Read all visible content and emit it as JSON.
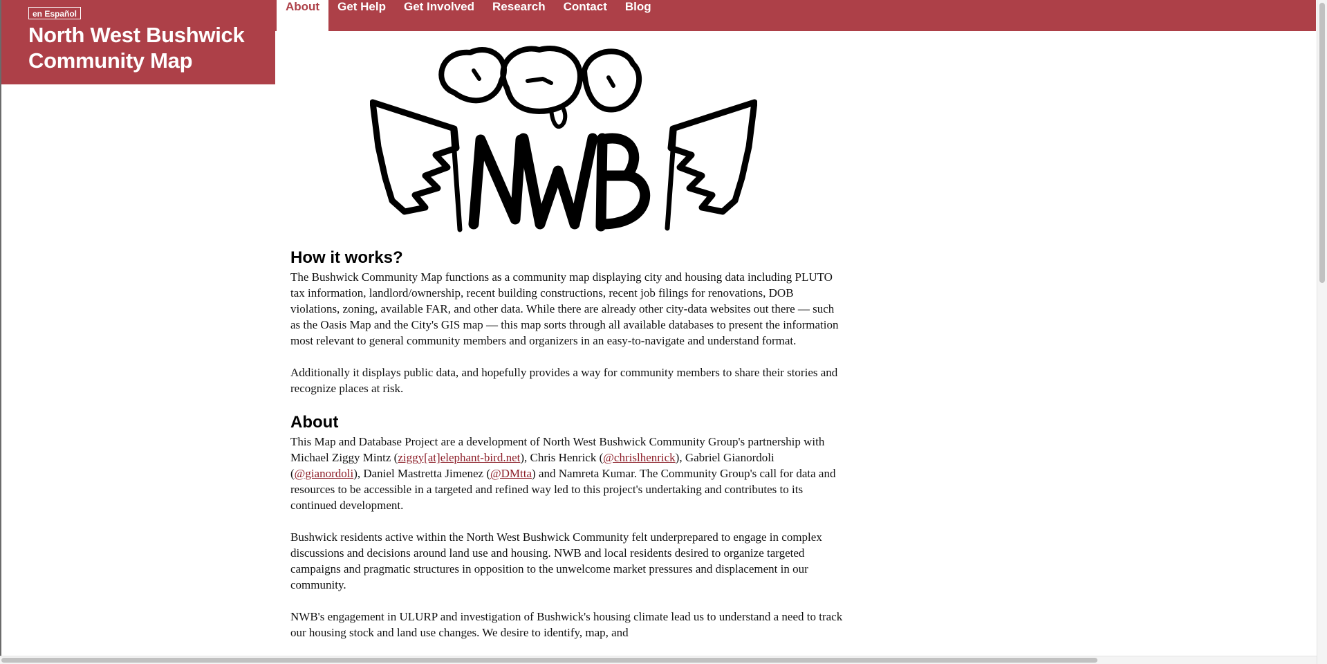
{
  "colors": {
    "brand": "#ad4048",
    "link": "#8b1c26"
  },
  "header": {
    "language_button": "en Español",
    "title": "North West Bushwick Community Map"
  },
  "nav": {
    "items": [
      {
        "label": "About",
        "active": true
      },
      {
        "label": "Get Help"
      },
      {
        "label": "Get Involved"
      },
      {
        "label": "Research"
      },
      {
        "label": "Contact"
      },
      {
        "label": "Blog"
      }
    ]
  },
  "logo": {
    "icon": "nwb-winged-logo",
    "text": "NWB"
  },
  "content": {
    "how_heading": "How it works?",
    "how_p1": "The Bushwick Community Map functions as a community map displaying city and housing data including PLUTO tax information, landlord/ownership, recent building constructions, recent job filings for renovations, DOB violations, zoning, available FAR, and other data. While there are already other city-data websites out there — such as the Oasis Map and the City's GIS map — this map sorts through all available databases to present the information most relevant to general community members and organizers in an easy-to-navigate and understand format.",
    "how_p2": "Additionally it displays public data, and hopefully provides a way for community members to share their stories and recognize places at risk.",
    "about_heading": "About",
    "about_p1": {
      "t1": "This Map and Database Project are a development of North West Bushwick Community Group's partnership with Michael Ziggy Mintz (",
      "link1": "ziggy[at]elephant-bird.net",
      "t2": "), Chris Henrick (",
      "link2": "@chrislhenrick",
      "t3": "), Gabriel Gianordoli (",
      "link3": "@gianordoli",
      "t4": "), Daniel Mastretta Jimenez (",
      "link4": "@DMtta",
      "t5": ") and Namreta Kumar. The Community Group's call for data and resources to be accessible in a targeted and refined way led to this project's undertaking and contributes to its continued development."
    },
    "about_p2": "Bushwick residents active within the North West Bushwick Community felt underprepared to engage in complex discussions and decisions around land use and housing. NWB and local residents desired to organize targeted campaigns and pragmatic structures in opposition to the unwelcome market pressures and displacement in our community.",
    "about_p3": "NWB's engagement in ULURP and investigation of Bushwick's housing climate lead us to understand a need to track our housing stock and land use changes. We desire to identify, map, and"
  }
}
